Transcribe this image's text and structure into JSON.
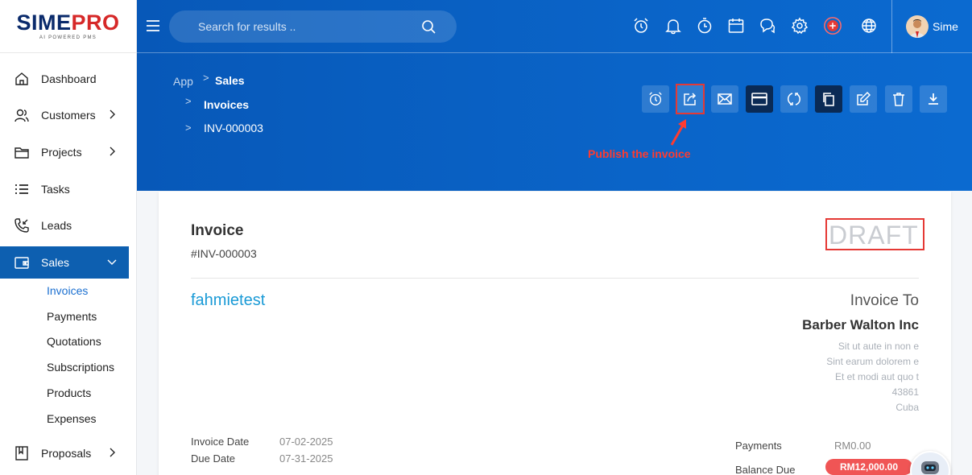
{
  "logo": {
    "brand_a": "SIME",
    "brand_b": "PRO",
    "tagline": "AI POWERED PMS"
  },
  "search": {
    "placeholder": "Search for results .."
  },
  "user": {
    "name": "Sime"
  },
  "sidebar": {
    "items": [
      {
        "label": "Dashboard"
      },
      {
        "label": "Customers"
      },
      {
        "label": "Projects"
      },
      {
        "label": "Tasks"
      },
      {
        "label": "Leads"
      },
      {
        "label": "Sales"
      },
      {
        "label": "Proposals"
      }
    ],
    "sales_sub": [
      "Invoices",
      "Payments",
      "Quotations",
      "Subscriptions",
      "Products",
      "Expenses"
    ]
  },
  "breadcrumb": {
    "app": "App",
    "sales": "Sales",
    "invoices": "Invoices",
    "invoice_id": "INV-000003"
  },
  "annotation": {
    "publish": "Publish the invoice"
  },
  "invoice": {
    "title": "Invoice",
    "number": "#INV-000003",
    "status": "DRAFT",
    "company": "fahmietest",
    "invoice_to_label": "Invoice To",
    "client_name": "Barber Walton Inc",
    "address_lines": [
      "Sit ut aute in non e",
      "Sint earum dolorem e",
      "Et et modi aut quo t",
      "43861",
      "Cuba"
    ],
    "invoice_date_label": "Invoice Date",
    "invoice_date": "07-02-2025",
    "due_date_label": "Due Date",
    "due_date": "07-31-2025",
    "payments_label": "Payments",
    "payments_value": "RM0.00",
    "balance_due_label": "Balance Due",
    "balance_due_value": "RM12,000.00"
  },
  "colors": {
    "header": "#0758b8",
    "active_nav": "#0d5fb0",
    "draft": "#c9ccd1",
    "highlight": "#e53935",
    "balance": "#f05555",
    "link": "#1a9ad6"
  }
}
